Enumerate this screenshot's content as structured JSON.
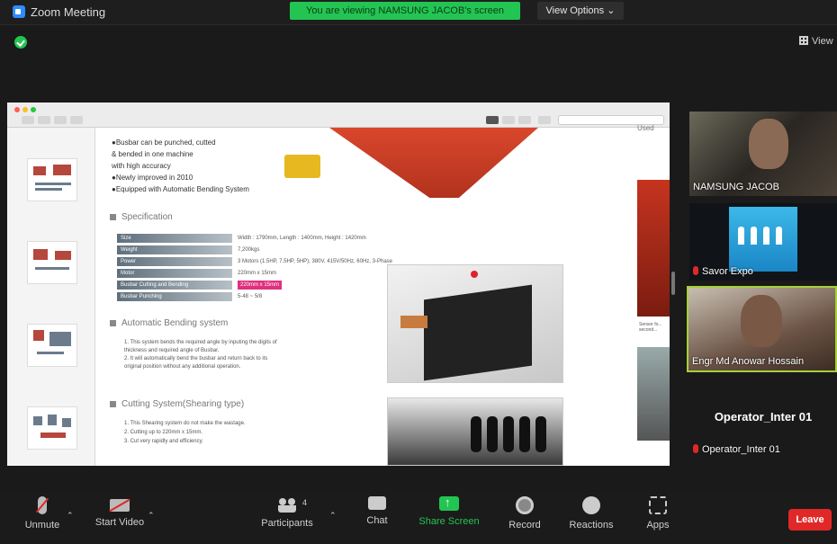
{
  "window": {
    "title": "Zoom Meeting",
    "viewing_banner": "You are viewing NAMSUNG JACOB's screen",
    "view_options": "View Options ⌄",
    "view_button": "View"
  },
  "shared_document": {
    "bullets": [
      "●Busbar can be punched, cutted",
      "  & bended in one machine",
      "  with high accuracy",
      "●Newly improved in 2010",
      "●Equipped with Automatic Bending System"
    ],
    "spec_title": "Specification",
    "spec_rows": [
      {
        "k": "Size",
        "v": "Width : 1790mm, Length : 1400mm, Height : 1420mm"
      },
      {
        "k": "Weight",
        "v": "7,200kgs"
      },
      {
        "k": "Power",
        "v": "3 Motors (1.5HP, 7.5HP, 5HP), 380V, 415V/50Hz, 60Hz, 3-Phase"
      },
      {
        "k": "Motor",
        "v": "220mm x 15mm"
      },
      {
        "k": "Busbar Cutting and Bending",
        "v": "220mm x 15mm"
      },
      {
        "k": "Busbar Punching",
        "v": "5-48 ~ 5/8"
      }
    ],
    "section_bending": "Automatic Bending system",
    "bending_paras": [
      "1. This system bends the required angle by inputing the digits of",
      "   thickness and required angle of Busbar.",
      "2. It will automatically bend the busbar and return back to its",
      "   original position without any additional operation."
    ],
    "section_cutting": "Cutting System(Shearing type)",
    "cutting_paras": [
      "1. This Shearing system do not make the wastage.",
      "2. Cutting up to 220mm x 15mm.",
      "3. Cut very rapidly and efficiency."
    ],
    "right_heading": "Used",
    "right_caption": "Sensor fo... second..."
  },
  "participants": [
    {
      "name": "NAMSUNG JACOB",
      "muted": false
    },
    {
      "name": "Savor Expo",
      "muted": true
    },
    {
      "name": "Engr Md Anowar Hossain",
      "muted": false,
      "active": true
    },
    {
      "name": "Operator_Inter 01",
      "muted": true,
      "video": false
    }
  ],
  "toolbar": {
    "unmute": "Unmute",
    "start_video": "Start Video",
    "participants": "Participants",
    "participants_count": "4",
    "chat": "Chat",
    "share_screen": "Share Screen",
    "record": "Record",
    "reactions": "Reactions",
    "apps": "Apps",
    "leave": "Leave"
  },
  "colors": {
    "share_green": "#23c552",
    "leave_red": "#e02828",
    "active_speaker": "#a6d13a",
    "zoom_blue": "#2d8cff"
  }
}
